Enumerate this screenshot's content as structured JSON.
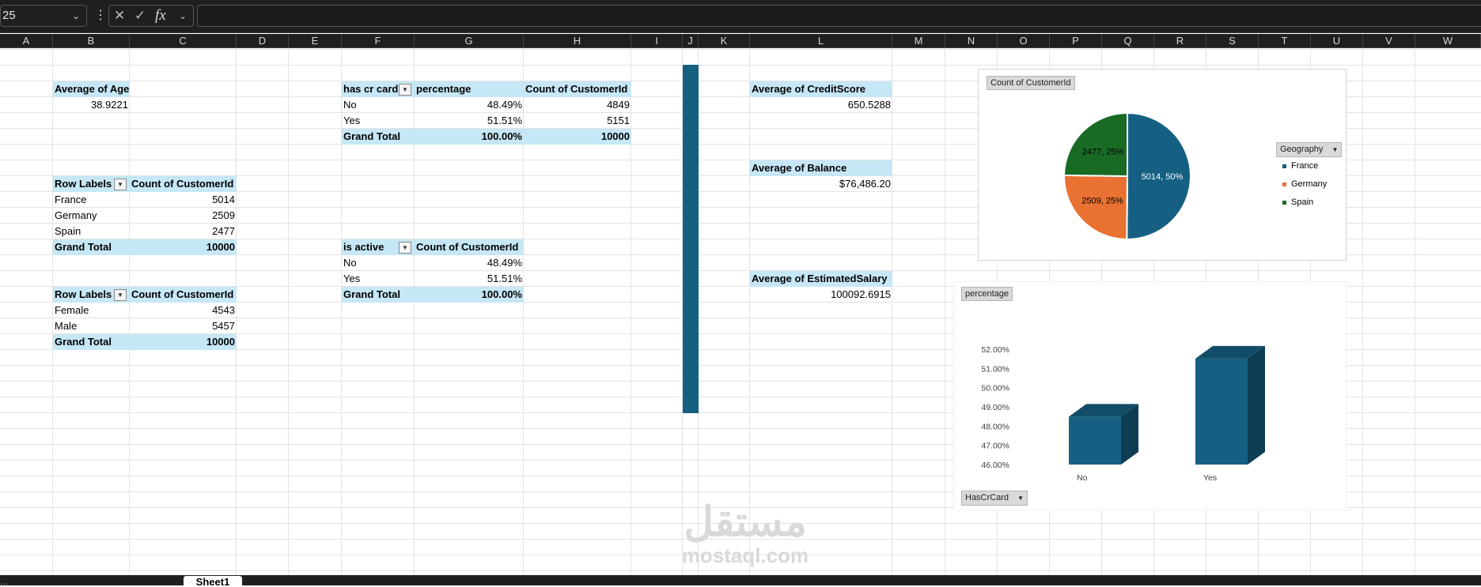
{
  "formula_bar": {
    "name_box": "25",
    "more_icon": "vertical-ellipsis-icon",
    "cancel_icon": "x-icon",
    "enter_icon": "check-icon",
    "function_label": "fx",
    "formula": ""
  },
  "columns": [
    "A",
    "B",
    "C",
    "D",
    "E",
    "F",
    "G",
    "H",
    "I",
    "J",
    "K",
    "L",
    "M",
    "N",
    "O",
    "P",
    "Q",
    "R",
    "S",
    "T",
    "U",
    "V",
    "W"
  ],
  "pivots": {
    "age": {
      "header": "Average of Age",
      "value": "38.9221"
    },
    "geo": {
      "col1": "Row Labels",
      "col2": "Count of CustomerId",
      "rows": [
        {
          "label": "France",
          "value": "5014"
        },
        {
          "label": "Germany",
          "value": "2509"
        },
        {
          "label": "Spain",
          "value": "2477"
        }
      ],
      "total_label": "Grand Total",
      "total_value": "10000"
    },
    "gender": {
      "col1": "Row Labels",
      "col2": "Count of CustomerId",
      "rows": [
        {
          "label": "Female",
          "value": "4543"
        },
        {
          "label": "Male",
          "value": "5457"
        }
      ],
      "total_label": "Grand Total",
      "total_value": "10000"
    },
    "crcard": {
      "col1": "has cr card",
      "col2": "percentage",
      "col3": "Count of CustomerId",
      "rows": [
        {
          "label": "No",
          "pct": "48.49%",
          "count": "4849"
        },
        {
          "label": "Yes",
          "pct": "51.51%",
          "count": "5151"
        }
      ],
      "total_label": "Grand Total",
      "total_pct": "100.00%",
      "total_count": "10000"
    },
    "active": {
      "col1": "is active",
      "col2": "Count of CustomerId",
      "rows": [
        {
          "label": "No",
          "value": "48.49%"
        },
        {
          "label": "Yes",
          "value": "51.51%"
        }
      ],
      "total_label": "Grand Total",
      "total_value": "100.00%"
    },
    "credit": {
      "header": "Average of CreditScore",
      "value": "650.5288"
    },
    "balance": {
      "header": "Average of Balance",
      "value": "$76,486.20"
    },
    "salary": {
      "header": "Average of EstimatedSalary",
      "value": "100092.6915"
    }
  },
  "pie_chart": {
    "field_button": "Count of CustomerId",
    "legend_button": "Geography",
    "colors": [
      "#156082",
      "#e97132",
      "#196b24"
    ]
  },
  "bar_chart": {
    "field_button": "percentage",
    "axis_button": "HasCrCard",
    "color": "#156082"
  },
  "chart_data": [
    {
      "type": "pie",
      "categories": [
        "France",
        "Germany",
        "Spain"
      ],
      "values": [
        5014,
        2509,
        2477
      ],
      "labels": [
        "5014, 50%",
        "2509, 25%",
        "2477, 25%"
      ],
      "legend": "right"
    },
    {
      "type": "bar",
      "categories": [
        "No",
        "Yes"
      ],
      "values": [
        48.49,
        51.51
      ],
      "ylim": [
        46,
        52
      ],
      "ytick_labels": [
        "46.00%",
        "47.00%",
        "48.00%",
        "49.00%",
        "50.00%",
        "51.00%",
        "52.00%"
      ],
      "grid": false
    }
  ],
  "tabs": {
    "active": "Sheet1"
  },
  "watermark": {
    "arabic": "مستقل",
    "latin": "mostaql.com"
  }
}
